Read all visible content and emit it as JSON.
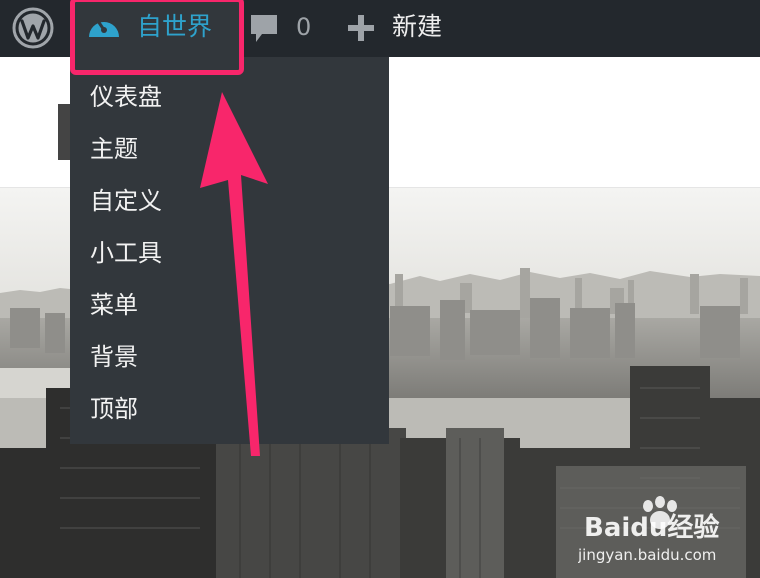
{
  "adminbar": {
    "site_name": "自世界",
    "comment_count": "0",
    "new_label": "新建"
  },
  "dropdown": {
    "items": [
      {
        "label": "仪表盘"
      },
      {
        "label": "主题"
      },
      {
        "label": "自定义"
      },
      {
        "label": "小工具"
      },
      {
        "label": "菜单"
      },
      {
        "label": "背景"
      },
      {
        "label": "顶部"
      }
    ]
  },
  "watermark": {
    "brand": "Baidu经验",
    "url": "jingyan.baidu.com"
  },
  "colors": {
    "adminbar_bg": "#23282d",
    "submenu_bg": "#32373c",
    "site_name_accent": "#2ea2cc",
    "annotation": "#f8266b"
  }
}
